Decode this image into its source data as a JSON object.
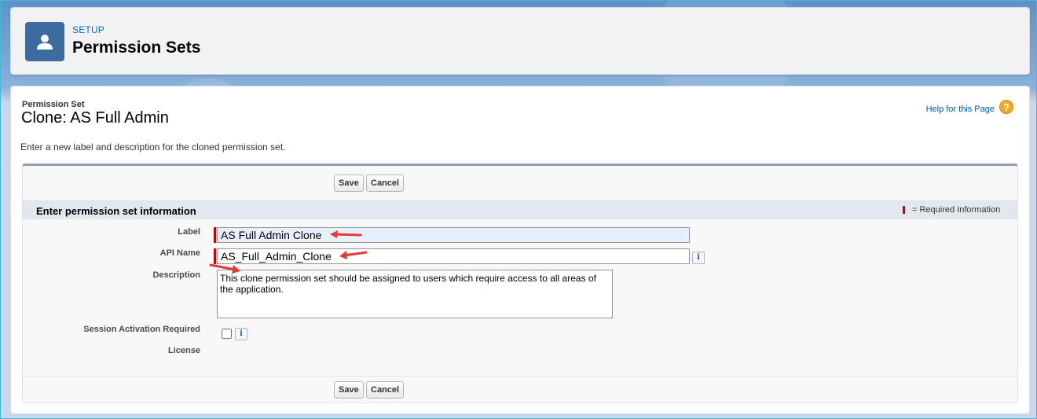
{
  "header": {
    "eyebrow": "SETUP",
    "title": "Permission Sets",
    "icon": "user-icon"
  },
  "page": {
    "record_type": "Permission Set",
    "title": "Clone: AS Full Admin",
    "help_link": "Help for this Page",
    "help_icon": "question-icon",
    "intro": "Enter a new label and description for the cloned permission set."
  },
  "form": {
    "buttons": {
      "save": "Save",
      "cancel": "Cancel"
    },
    "section_title": "Enter permission set information",
    "required_legend": "= Required Information",
    "fields": {
      "label": {
        "label": "Label",
        "value": "AS Full Admin Clone"
      },
      "api_name": {
        "label": "API Name",
        "value": "AS_Full_Admin_Clone"
      },
      "description": {
        "label": "Description",
        "value": "This clone permission set should be assigned to users which require access to all areas of the application."
      },
      "session_activation": {
        "label": "Session Activation Required",
        "checked": false
      },
      "license": {
        "label": "License",
        "value": ""
      }
    }
  },
  "colors": {
    "required": "#cc0000",
    "annotation_arrow": "#e53935",
    "header_icon_bg": "#3c6b9f",
    "link": "#015ba7"
  }
}
